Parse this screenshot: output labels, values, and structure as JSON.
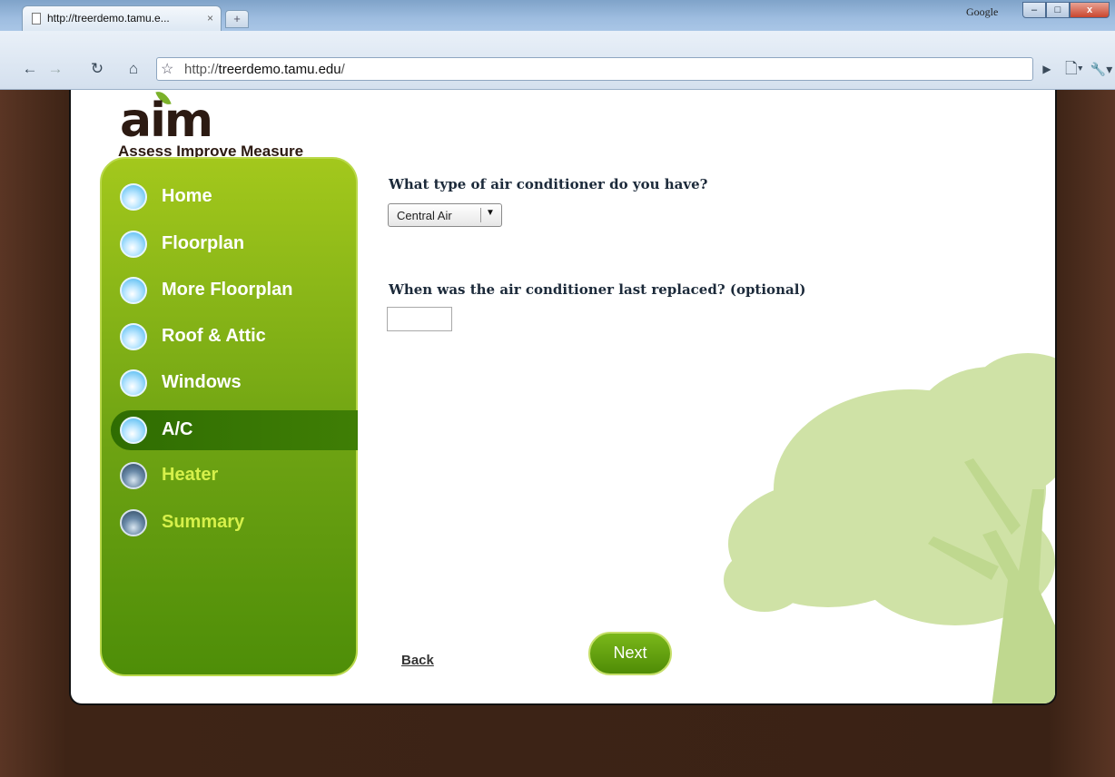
{
  "browser": {
    "tab_title": "http://treerdemo.tamu.e...",
    "tab_close": "×",
    "new_tab": "+",
    "right_label": "Google",
    "url_scheme": "http://",
    "url_host": "treerdemo.tamu.edu",
    "url_path": "/",
    "window_buttons": [
      "–",
      "□",
      "x"
    ]
  },
  "logo": {
    "word": "aim",
    "tagline": "Assess Improve Measure"
  },
  "sidebar": {
    "items": [
      {
        "label": "Home"
      },
      {
        "label": "Floorplan"
      },
      {
        "label": "More Floorplan"
      },
      {
        "label": "Roof & Attic"
      },
      {
        "label": "Windows"
      },
      {
        "label": "A/C"
      },
      {
        "label": "Heater"
      },
      {
        "label": "Summary"
      }
    ]
  },
  "form": {
    "q1": "What type of air conditioner do you have?",
    "q1_value": "Central Air",
    "q2": "When was the air conditioner last replaced? (optional)",
    "q2_value": ""
  },
  "actions": {
    "back": "Back",
    "next": "Next"
  },
  "colors": {
    "sidebar_green": "#6ea313",
    "active_green": "#2f6d02",
    "page_brown": "#3e2416",
    "tree": "#c9dfa0"
  }
}
